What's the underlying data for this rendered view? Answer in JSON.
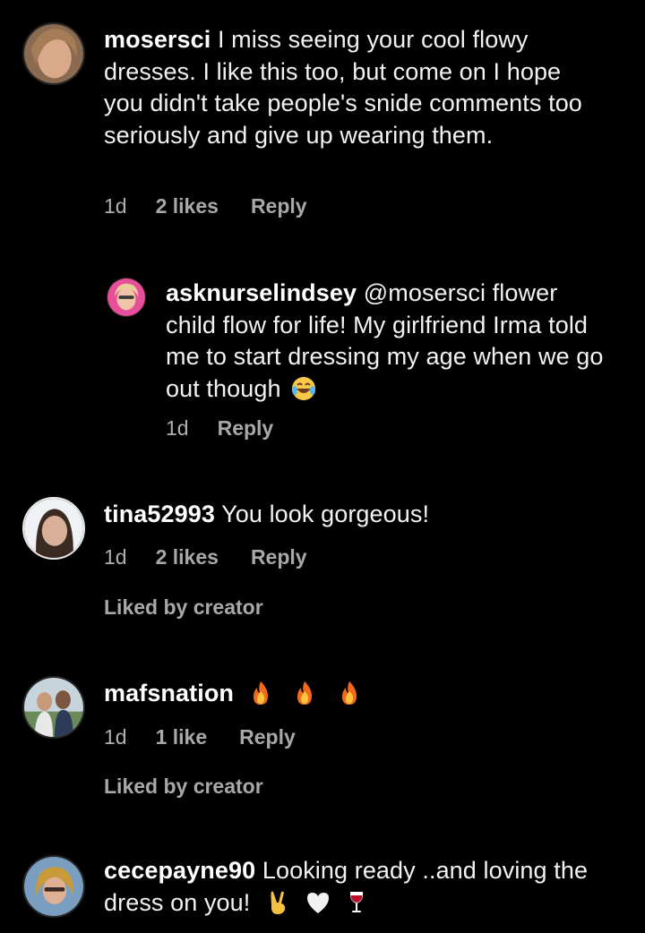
{
  "comments": [
    {
      "username": "mosersci",
      "text": "I miss seeing your cool flowy dresses. I like this too, but come on I hope you didn't take people's  snide comments too seriously and give up wearing them.",
      "time": "1d",
      "likes": "2 likes",
      "reply": "Reply",
      "avatar_icon": "user-avatar-icon"
    },
    {
      "username": "asknurselindsey",
      "text": "@mosersci flower child flow for life! My girlfriend Irma told me to start dressing my age when we go out though",
      "time": "1d",
      "reply": "Reply",
      "emoji": "laughing-tears-emoji",
      "avatar_icon": "user-avatar-icon"
    },
    {
      "username": "tina52993",
      "text": "You look gorgeous!",
      "time": "1d",
      "likes": "2 likes",
      "reply": "Reply",
      "liked_by": "Liked by creator",
      "avatar_icon": "user-avatar-icon"
    },
    {
      "username": "mafsnation",
      "text": "",
      "emoji": [
        "fire-emoji",
        "fire-emoji",
        "fire-emoji"
      ],
      "time": "1d",
      "likes": "1 like",
      "reply": "Reply",
      "liked_by": "Liked by creator",
      "avatar_icon": "user-avatar-icon"
    },
    {
      "username": "cecepayne90",
      "text": "Looking ready ..and loving the dress on you!",
      "emoji": [
        "victory-hand-emoji",
        "white-heart-emoji",
        "wine-glass-emoji"
      ],
      "avatar_icon": "user-avatar-icon"
    }
  ],
  "colors": {
    "background": "#000000",
    "text": "#f2f2f2",
    "meta": "#a8a8a8"
  }
}
